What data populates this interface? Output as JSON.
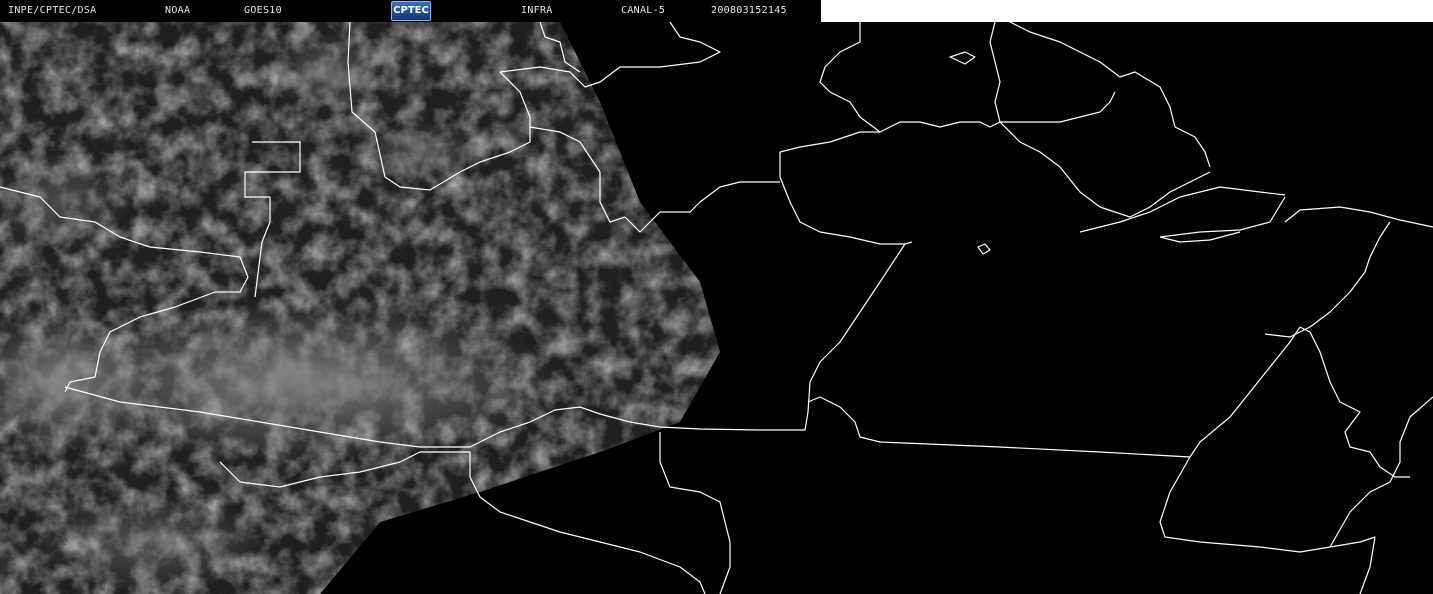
{
  "header": {
    "institution": "INPE/CPTEC/DSA",
    "agency": "NOAA",
    "satellite": "GOES10",
    "logo_text": "CPTEC",
    "product": "INFRA",
    "channel": "CANAL-5",
    "timestamp": "200803152145"
  },
  "colors": {
    "background": "#000000",
    "border_lines": "#ffffff",
    "cloud_tone": "#5a5a5a",
    "header_text": "#e8e8e8"
  }
}
